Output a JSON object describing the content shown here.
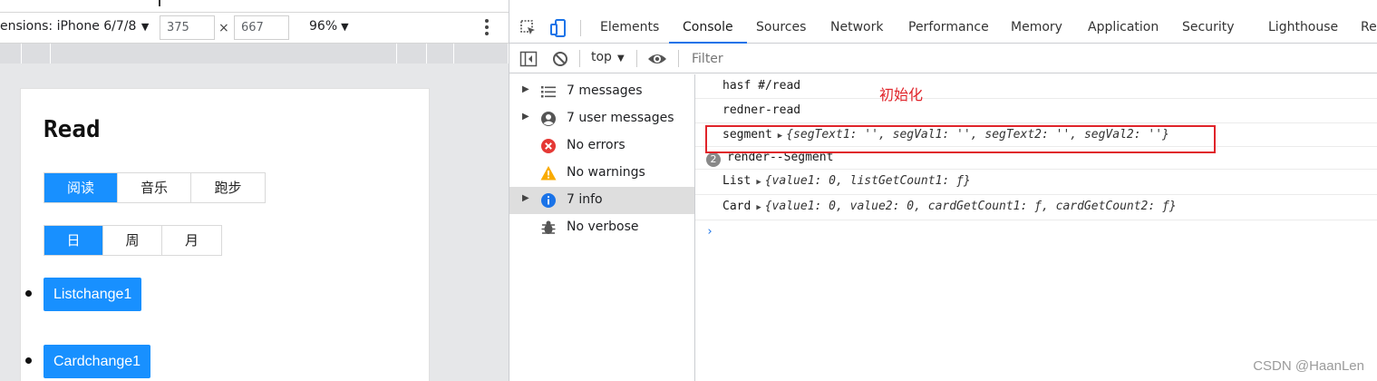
{
  "device_toolbar": {
    "dimensions_label": "ensions: iPhone 6/7/8",
    "width": "375",
    "times": "×",
    "height": "667",
    "zoom": "96%"
  },
  "page": {
    "title": "Read",
    "segment1": [
      "阅读",
      "音乐",
      "跑步"
    ],
    "segment2": [
      "日",
      "周",
      "月"
    ],
    "buttons": [
      "Listchange1",
      "Cardchange1"
    ]
  },
  "devtools": {
    "tabs": [
      "Elements",
      "Console",
      "Sources",
      "Network",
      "Performance",
      "Memory",
      "Application",
      "Security",
      "Lighthouse",
      "Re"
    ],
    "active_tab": "Console",
    "context": "top",
    "filter_placeholder": "Filter"
  },
  "sidebar": {
    "items": [
      {
        "label": "7 messages",
        "icon": "list-icon"
      },
      {
        "label": "7 user messages",
        "icon": "user-icon"
      },
      {
        "label": "No errors",
        "icon": "error-icon"
      },
      {
        "label": "No warnings",
        "icon": "warning-icon"
      },
      {
        "label": "7 info",
        "icon": "info-icon"
      },
      {
        "label": "No verbose",
        "icon": "bug-icon"
      }
    ]
  },
  "console": {
    "lines": [
      {
        "text": "hasf #/read"
      },
      {
        "text": "redner-read"
      },
      {
        "text": "segment",
        "object": "{segText1: '', segVal1: '', segText2: '', segVal2: ''}"
      },
      {
        "text": "render--Segment",
        "count": "2"
      },
      {
        "text": "List",
        "object": "{value1: 0, listGetCount1: ƒ}"
      },
      {
        "text": "Card",
        "object": "{value1: 0, value2: 0, cardGetCount1: ƒ, cardGetCount2: ƒ}"
      }
    ],
    "prompt": "›"
  },
  "annotation": "初始化",
  "watermark": "CSDN @HaanLen",
  "colors": {
    "accent": "#1890ff",
    "devtools_blue": "#1a73e8",
    "annotation_red": "#e0242a"
  }
}
